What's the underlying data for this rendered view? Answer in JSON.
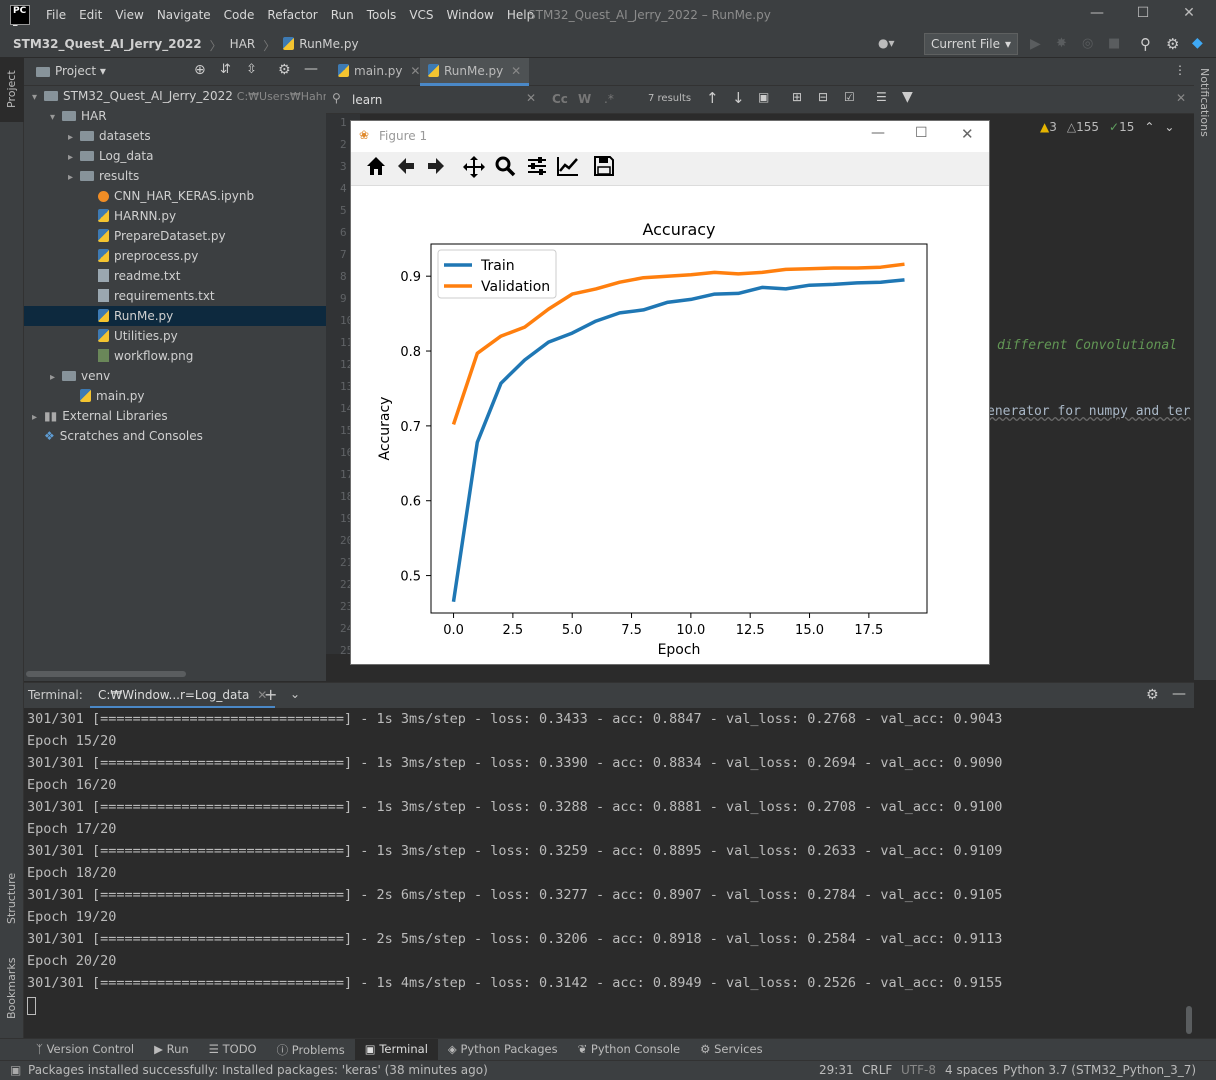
{
  "menu": [
    "File",
    "Edit",
    "View",
    "Navigate",
    "Code",
    "Refactor",
    "Run",
    "Tools",
    "VCS",
    "Window",
    "Help"
  ],
  "window_title": "STM32_Quest_AI_Jerry_2022 – RunMe.py",
  "breadcrumbs": [
    "STM32_Quest_AI_Jerry_2022",
    "HAR",
    "RunMe.py"
  ],
  "run_config": "Current File",
  "project_panel": {
    "title": "Project",
    "tree": [
      {
        "label": "STM32_Quest_AI_Jerry_2022",
        "hint": "C:₩Users₩Hahm",
        "type": "folder",
        "indent": 0,
        "arrow": "▾"
      },
      {
        "label": "HAR",
        "type": "folder",
        "indent": 1,
        "arrow": "▾"
      },
      {
        "label": "datasets",
        "type": "folder",
        "indent": 2,
        "arrow": "▸"
      },
      {
        "label": "Log_data",
        "type": "folder",
        "indent": 2,
        "arrow": "▸"
      },
      {
        "label": "results",
        "type": "folder",
        "indent": 2,
        "arrow": "▸"
      },
      {
        "label": "CNN_HAR_KERAS.ipynb",
        "type": "nb",
        "indent": 3
      },
      {
        "label": "HARNN.py",
        "type": "py",
        "indent": 3
      },
      {
        "label": "PrepareDataset.py",
        "type": "py",
        "indent": 3
      },
      {
        "label": "preprocess.py",
        "type": "py",
        "indent": 3
      },
      {
        "label": "readme.txt",
        "type": "txt",
        "indent": 3
      },
      {
        "label": "requirements.txt",
        "type": "txt",
        "indent": 3
      },
      {
        "label": "RunMe.py",
        "type": "py",
        "indent": 3,
        "selected": true
      },
      {
        "label": "Utilities.py",
        "type": "py",
        "indent": 3
      },
      {
        "label": "workflow.png",
        "type": "png",
        "indent": 3
      },
      {
        "label": "venv",
        "type": "folder",
        "indent": 1,
        "arrow": "▸"
      },
      {
        "label": "main.py",
        "type": "py",
        "indent": 2
      },
      {
        "label": "External Libraries",
        "type": "lib",
        "indent": 0,
        "arrow": "▸"
      },
      {
        "label": "Scratches and Consoles",
        "type": "scratch",
        "indent": 0
      }
    ]
  },
  "editor": {
    "tabs": [
      {
        "label": "main.py",
        "active": false
      },
      {
        "label": "RunMe.py",
        "active": true
      }
    ],
    "search_text": "learn",
    "search_results": "7 results",
    "inspections": {
      "warnings": "3",
      "weak": "155",
      "typos": "15"
    },
    "line_numbers": [
      "1",
      "2",
      "3",
      "4",
      "5",
      "6",
      "7",
      "8",
      "9",
      "10",
      "11",
      "12",
      "13",
      "14",
      "15",
      "16",
      "17",
      "18",
      "19",
      "20",
      "21",
      "22",
      "23",
      "24",
      "25"
    ],
    "code_snippets": [
      "different Convolutional",
      "enerator for numpy and ter"
    ]
  },
  "figure": {
    "window_title": "Figure 1",
    "toolbar": [
      "home-icon",
      "back-icon",
      "forward-icon",
      "pan-icon",
      "zoom-icon",
      "configure-icon",
      "axes-icon",
      "save-icon"
    ]
  },
  "chart_data": {
    "type": "line",
    "title": "Accuracy",
    "xlabel": "Epoch",
    "ylabel": "Accuracy",
    "xlim": [
      -0.95,
      19.95
    ],
    "ylim": [
      0.45,
      0.943
    ],
    "xticks": [
      "0.0",
      "2.5",
      "5.0",
      "7.5",
      "10.0",
      "12.5",
      "15.0",
      "17.5"
    ],
    "yticks": [
      "0.5",
      "0.6",
      "0.7",
      "0.8",
      "0.9"
    ],
    "legend_position": "upper-left",
    "grid": false,
    "x": [
      0,
      1,
      2,
      3,
      4,
      5,
      6,
      7,
      8,
      9,
      10,
      11,
      12,
      13,
      14,
      15,
      16,
      17,
      18,
      19
    ],
    "series": [
      {
        "name": "Train",
        "color": "#1f77b4",
        "values": [
          0.465,
          0.678,
          0.757,
          0.788,
          0.812,
          0.824,
          0.84,
          0.851,
          0.855,
          0.865,
          0.869,
          0.876,
          0.877,
          0.885,
          0.883,
          0.888,
          0.889,
          0.891,
          0.892,
          0.895
        ]
      },
      {
        "name": "Validation",
        "color": "#ff7f0e",
        "values": [
          0.702,
          0.797,
          0.82,
          0.832,
          0.856,
          0.876,
          0.883,
          0.892,
          0.898,
          0.9,
          0.902,
          0.905,
          0.903,
          0.905,
          0.909,
          0.91,
          0.911,
          0.911,
          0.912,
          0.916
        ]
      }
    ]
  },
  "terminal": {
    "label": "Terminal:",
    "tab": "C:₩Window...r=Log_data",
    "lines": [
      "301/301 [==============================] - 1s 3ms/step - loss: 0.3433 - acc: 0.8847 - val_loss: 0.2768 - val_acc: 0.9043",
      "Epoch 15/20",
      "301/301 [==============================] - 1s 3ms/step - loss: 0.3390 - acc: 0.8834 - val_loss: 0.2694 - val_acc: 0.9090",
      "Epoch 16/20",
      "301/301 [==============================] - 1s 3ms/step - loss: 0.3288 - acc: 0.8881 - val_loss: 0.2708 - val_acc: 0.9100",
      "Epoch 17/20",
      "301/301 [==============================] - 1s 3ms/step - loss: 0.3259 - acc: 0.8895 - val_loss: 0.2633 - val_acc: 0.9109",
      "Epoch 18/20",
      "301/301 [==============================] - 2s 6ms/step - loss: 0.3277 - acc: 0.8907 - val_loss: 0.2784 - val_acc: 0.9105",
      "Epoch 19/20",
      "301/301 [==============================] - 2s 5ms/step - loss: 0.3206 - acc: 0.8918 - val_loss: 0.2584 - val_acc: 0.9113",
      "Epoch 20/20",
      "301/301 [==============================] - 1s 4ms/step - loss: 0.3142 - acc: 0.8949 - val_loss: 0.2526 - val_acc: 0.9155"
    ]
  },
  "side_tabs": {
    "left_top": "Project",
    "left_bottom": [
      "Structure",
      "Bookmarks"
    ],
    "right": "Notifications"
  },
  "tool_windows": [
    "Version Control",
    "Run",
    "TODO",
    "Problems",
    "Terminal",
    "Python Packages",
    "Python Console",
    "Services"
  ],
  "status": {
    "message": "Packages installed successfully: Installed packages: 'keras' (38 minutes ago)",
    "position": "29:31",
    "line_sep": "CRLF",
    "encoding": "UTF-8",
    "indent": "4 spaces",
    "interpreter": "Python 3.7 (STM32_Python_3_7)"
  }
}
